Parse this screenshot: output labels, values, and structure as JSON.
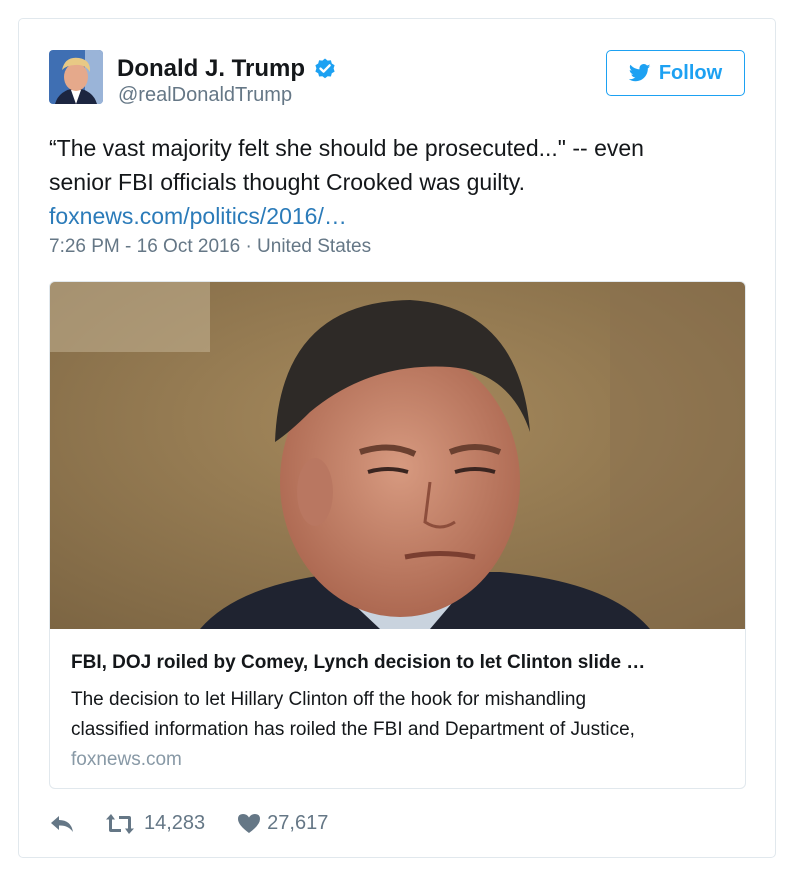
{
  "author": {
    "name": "Donald J. Trump",
    "handle": "@realDonaldTrump"
  },
  "follow_button": {
    "label": "Follow",
    "icon": "twitter-bird-icon"
  },
  "tweet": {
    "text_line1": "“The vast majority felt she should be prosecuted...\" -- even",
    "text_line2": "senior FBI officials thought Crooked was guilty.",
    "link_text": "foxnews.com/politics/2016/…",
    "timestamp": "7:26 PM - 16 Oct 2016 · United States"
  },
  "card": {
    "title": "FBI, DOJ roiled by Comey, Lynch decision to let Clinton slide …",
    "description_line1": "The decision to let Hillary Clinton off the hook for mishandling",
    "description_line2": "classified information has roiled the FBI and Department of Justice,",
    "domain": "foxnews.com"
  },
  "actions": {
    "retweets": "14,283",
    "likes": "27,617"
  },
  "colors": {
    "accent": "#1da1f2",
    "link": "#2b7bb9",
    "secondary_text": "#657786",
    "border": "#e1e8ed"
  }
}
